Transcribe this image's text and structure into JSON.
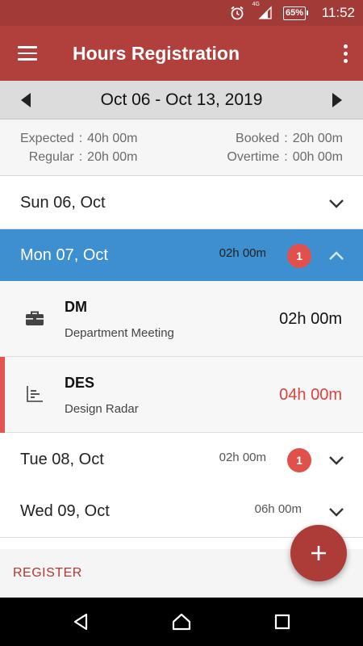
{
  "status_bar": {
    "network": "4G",
    "battery": "65%",
    "time": "11:52",
    "icons": [
      "alarm-icon",
      "signal-icon",
      "battery-icon"
    ]
  },
  "app_bar": {
    "title": "Hours Registration",
    "icons": [
      "menu-icon",
      "more-vert-icon"
    ]
  },
  "week_nav": {
    "range": "Oct 06 - Oct 13, 2019"
  },
  "summary": {
    "expected_label": "Expected",
    "expected_value": "40h 00m",
    "regular_label": "Regular",
    "regular_value": "20h 00m",
    "booked_label": "Booked",
    "booked_value": "20h 00m",
    "overtime_label": "Overtime",
    "overtime_value": "00h 00m",
    "separator": ":"
  },
  "days": [
    {
      "label": "Sun 06, Oct",
      "hours": "",
      "badge": "",
      "expanded": false
    },
    {
      "label": "Mon 07, Oct",
      "hours": "02h 00m",
      "badge": "1",
      "expanded": true
    },
    {
      "label": "Tue 08, Oct",
      "hours": "02h 00m",
      "badge": "1",
      "expanded": false
    },
    {
      "label": "Wed 09, Oct",
      "hours": "06h 00m",
      "badge": "",
      "expanded": false
    }
  ],
  "entries": [
    {
      "code": "DM",
      "name": "Department Meeting",
      "hours": "02h 00m",
      "icon": "briefcase-icon"
    },
    {
      "code": "DES",
      "name": "Design Radar",
      "hours": "04h 00m",
      "icon": "project-chart-icon"
    }
  ],
  "register": {
    "label": "REGISTER"
  },
  "colors": {
    "primary": "#b13f3c",
    "status_bar": "#a23a37",
    "active_day": "#3d8fd0",
    "badge": "#e1514b",
    "warning_hours": "#e0413b"
  }
}
